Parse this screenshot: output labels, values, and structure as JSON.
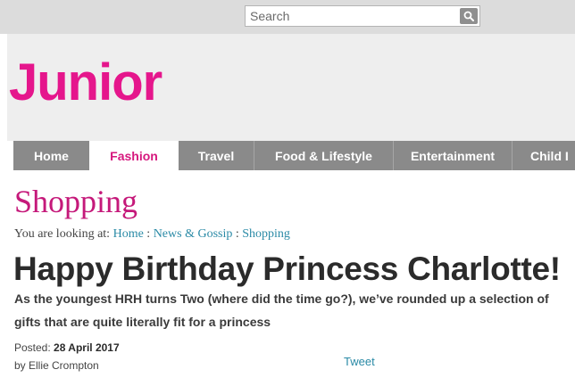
{
  "search": {
    "placeholder": "Search"
  },
  "brand": {
    "logo_text": "Junior",
    "accent_color": "#e5168c"
  },
  "nav": {
    "items": [
      {
        "label": "Home"
      },
      {
        "label": "Fashion",
        "active": true
      },
      {
        "label": "Travel"
      },
      {
        "label": "Food & Lifestyle"
      },
      {
        "label": "Entertainment"
      },
      {
        "label": "Child I"
      }
    ]
  },
  "page": {
    "section_title": "Shopping",
    "breadcrumb": {
      "prefix": "You are looking at:",
      "items": [
        "Home",
        "News & Gossip",
        "Shopping"
      ],
      "separator": " : "
    }
  },
  "article": {
    "headline": "Happy Birthday Princess Charlotte!",
    "standfirst": "As the youngest HRH turns Two (where did the time go?), we’ve rounded up a selection of gifts that are quite literally fit for a princess",
    "posted_label": "Posted:",
    "posted_date": "28 April 2017",
    "author": "by Ellie Crompton",
    "tweet_label": "Tweet"
  }
}
